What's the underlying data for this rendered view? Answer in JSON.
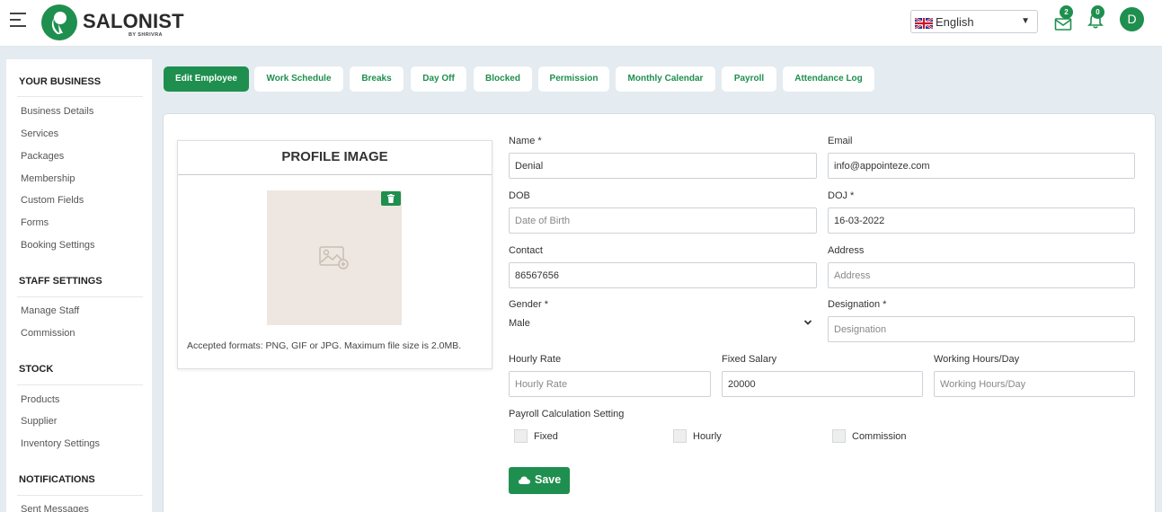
{
  "header": {
    "brand": "SALONIST",
    "brand_sub": "BY SHRIVRA",
    "language": "English",
    "messages_count": "2",
    "notifications_count": "0",
    "avatar_initial": "D"
  },
  "colors": {
    "accent": "#1e8f4e",
    "background": "#e4ebf1"
  },
  "sidebar": {
    "sections": [
      {
        "title": "YOUR BUSINESS",
        "items": [
          "Business Details",
          "Services",
          "Packages",
          "Membership",
          "Custom Fields",
          "Forms",
          "Booking Settings"
        ]
      },
      {
        "title": "STAFF SETTINGS",
        "items": [
          "Manage Staff",
          "Commission"
        ]
      },
      {
        "title": "STOCK",
        "items": [
          "Products",
          "Supplier",
          "Inventory Settings"
        ]
      },
      {
        "title": "NOTIFICATIONS",
        "items": [
          "Sent Messages"
        ]
      }
    ]
  },
  "tabs": [
    "Edit Employee",
    "Work Schedule",
    "Breaks",
    "Day Off",
    "Blocked",
    "Permission",
    "Monthly Calendar",
    "Payroll",
    "Attendance Log"
  ],
  "active_tab": "Edit Employee",
  "profile": {
    "title": "PROFILE IMAGE",
    "accepted": "Accepted formats: PNG, GIF or JPG. Maximum file size is 2.0MB."
  },
  "form": {
    "name": {
      "label": "Name *",
      "value": "Denial"
    },
    "email": {
      "label": "Email",
      "value": "info@appointeze.com"
    },
    "dob": {
      "label": "DOB",
      "placeholder": "Date of Birth"
    },
    "doj": {
      "label": "DOJ *",
      "value": "16-03-2022"
    },
    "contact": {
      "label": "Contact",
      "value": "86567656"
    },
    "address": {
      "label": "Address",
      "placeholder": "Address"
    },
    "gender": {
      "label": "Gender *",
      "value": "Male"
    },
    "designation": {
      "label": "Designation *",
      "placeholder": "Designation"
    },
    "hourly_rate": {
      "label": "Hourly Rate",
      "placeholder": "Hourly Rate"
    },
    "fixed_salary": {
      "label": "Fixed Salary",
      "value": "20000"
    },
    "working_hours": {
      "label": "Working Hours/Day",
      "placeholder": "Working Hours/Day"
    },
    "payroll_setting": {
      "label": "Payroll Calculation Setting",
      "options": [
        "Fixed",
        "Hourly",
        "Commission"
      ]
    },
    "save_label": "Save"
  }
}
